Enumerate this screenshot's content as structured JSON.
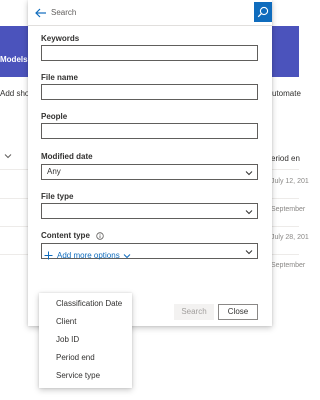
{
  "background": {
    "nav_label": "Models",
    "command_left": "Add shor",
    "command_right": "utomate",
    "column_header": "eriod en",
    "dates": [
      "July 12, 201",
      "September",
      "July 28, 201",
      "September"
    ]
  },
  "search_panel": {
    "search_placeholder": "Search",
    "fields": {
      "keywords_label": "Keywords",
      "keywords_value": "",
      "file_name_label": "File name",
      "file_name_value": "",
      "people_label": "People",
      "people_value": "",
      "modified_date_label": "Modified date",
      "modified_date_value": "Any",
      "file_type_label": "File type",
      "file_type_value": "",
      "content_type_label": "Content type",
      "content_type_value": ""
    },
    "add_more_label": "Add more options",
    "search_button": "Search",
    "close_button": "Close"
  },
  "options_menu": {
    "items": [
      "Classification Date",
      "Client",
      "Job ID",
      "Period end",
      "Service type"
    ]
  },
  "colors": {
    "accent": "#0f6cbd",
    "header_band": "#4b53bc"
  },
  "icons": [
    "back-arrow-icon",
    "search-icon",
    "chevron-down-icon",
    "info-icon",
    "plus-icon"
  ]
}
